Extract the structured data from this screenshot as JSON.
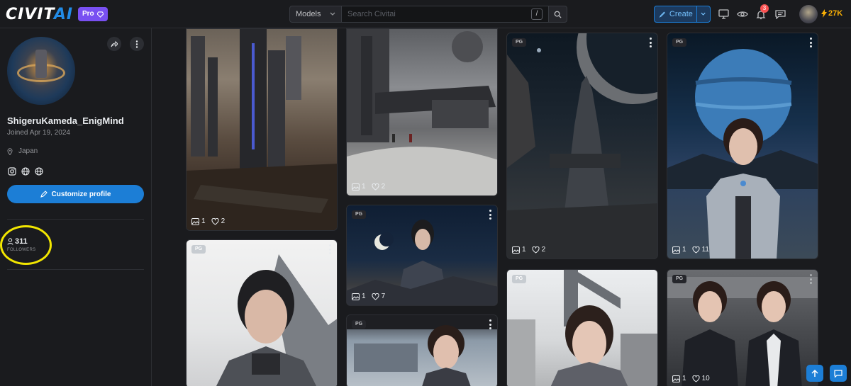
{
  "header": {
    "logo_left": "CIVIT",
    "logo_right": "AI",
    "pro_label": "Pro",
    "search": {
      "scope": "Models",
      "placeholder": "Search Civitai",
      "shortcut": "/"
    },
    "create_label": "Create",
    "notification_count": "3",
    "buzz_amount": "27K",
    "colors": {
      "accent": "#1c7ed6",
      "pro": "#7950f2",
      "buzz": "#fab005"
    }
  },
  "profile": {
    "username": "ShigeruKameda_EnigMind",
    "joined": "Joined Apr 19, 2024",
    "location": "Japan",
    "socials": [
      "instagram-icon",
      "globe-icon",
      "globe-icon"
    ],
    "customize_label": "Customize profile",
    "followers_count": "311",
    "followers_label": "FOLLOWERS"
  },
  "gallery": {
    "cards": [
      {
        "rating": "",
        "images": "1",
        "likes": "2",
        "scene": "desert city"
      },
      {
        "rating": "PG",
        "images": "",
        "likes": "",
        "scene": "girl in suit"
      },
      {
        "rating": "",
        "images": "1",
        "likes": "2",
        "scene": "moon base"
      },
      {
        "rating": "PG",
        "images": "1",
        "likes": "7",
        "scene": "girl with moon"
      },
      {
        "rating": "PG",
        "images": "",
        "likes": "",
        "scene": "smiling girl"
      },
      {
        "rating": "PG",
        "images": "1",
        "likes": "2",
        "scene": "alien city planet"
      },
      {
        "rating": "PG",
        "images": "",
        "likes": "",
        "scene": "bob hair girl"
      },
      {
        "rating": "PG",
        "images": "1",
        "likes": "11",
        "scene": "girl and jupiter"
      },
      {
        "rating": "PG",
        "images": "1",
        "likes": "10",
        "scene": "two girls"
      }
    ]
  }
}
